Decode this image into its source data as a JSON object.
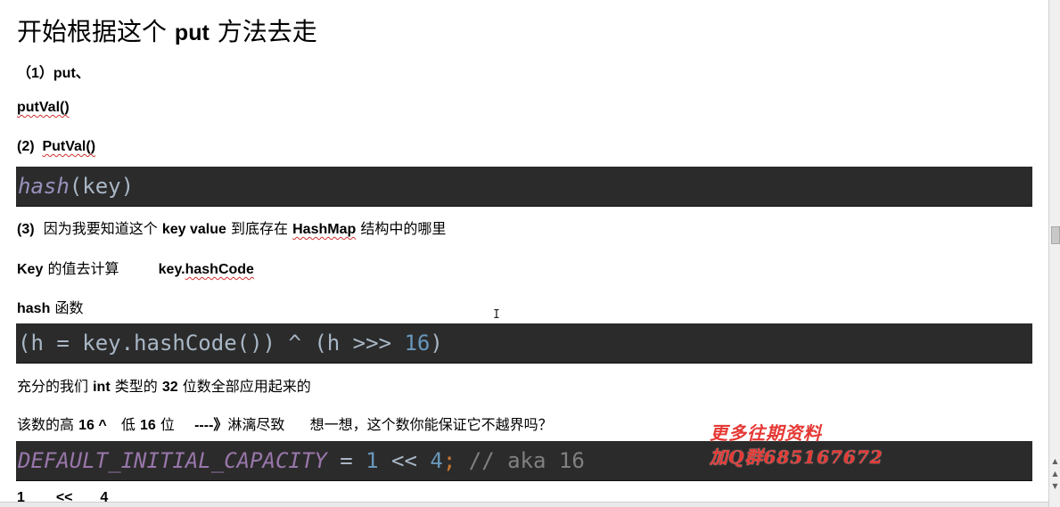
{
  "doc": {
    "title_a": "开始根据这个",
    "title_b": "put",
    "title_c": "方法去走",
    "l1_a": "（1）put、",
    "l2_a": "putVal()",
    "l3_a": "(2)",
    "l3_b": "PutVal()",
    "code1": {
      "fn": "hash",
      "rest": "(key)"
    },
    "l4_a": "(3)",
    "l4_b": "因为我要知道这个",
    "l4_c": "key value",
    "l4_d": "到底存在",
    "l4_e": "HashMap",
    "l4_f": "结构中的哪里",
    "l5_a": "Key",
    "l5_b": "的值去计算",
    "l5_c": "key.",
    "l5_d": "hashCode",
    "l6_a": "hash",
    "l6_b": "函数",
    "code2": {
      "a": "(h = key.",
      "b": "hashCode",
      "c": "()) ^ (h >>> ",
      "num": "16",
      "d": ")"
    },
    "l7_a": "充分的我们",
    "l7_b": "int",
    "l7_c": "类型的",
    "l7_d": "32",
    "l7_e": "位数全部应用起来的",
    "l8_a": "该数的高",
    "l8_b": "16 ^",
    "l8_c": "低",
    "l8_d": "16",
    "l8_e": "位",
    "l8_f": "----》",
    "l8_g": "淋漓尽致",
    "l8_h": "想一想，这个数你能保证它不越界吗？",
    "code3": {
      "const": "DEFAULT_INITIAL_CAPACITY",
      "eq": " = ",
      "n1": "1",
      "op": " << ",
      "n2": "4",
      "semi": ";",
      "cmt": " // aka 16"
    },
    "l9_a": "1",
    "l9_b": "<<",
    "l9_c": "4"
  },
  "watermark": {
    "line1": "更多往期资料",
    "line2": "加Q群685167672"
  },
  "colors": {
    "code_bg": "#2b2b2b",
    "code_text": "#a9b7c6",
    "code_num": "#6897bb",
    "code_const": "#9876aa",
    "code_comment": "#808080",
    "watermark": "#e53935",
    "spellcheck": "#d32f2f"
  }
}
